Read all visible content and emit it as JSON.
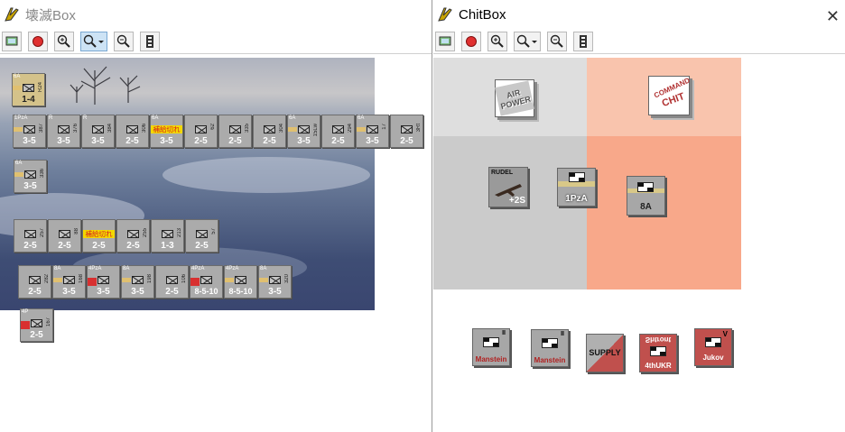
{
  "left_window": {
    "title": "壊滅Box",
    "toolbar": [
      "map-icon",
      "stop-icon",
      "zoom-in-icon",
      "zoom-dropdown-icon",
      "zoom-out-icon",
      "stack-icon"
    ],
    "counters": [
      {
        "lbl": "6A",
        "id": "R24",
        "str": "1-4",
        "style": "gold"
      },
      {
        "lbl": "1PzA",
        "id": "387",
        "str": "3-5"
      },
      {
        "lbl": "R",
        "id": "376",
        "str": "3-5"
      },
      {
        "lbl": "R",
        "id": "384",
        "str": "3-5"
      },
      {
        "lbl": "",
        "id": "306",
        "str": "2-5"
      },
      {
        "lbl": "6A",
        "id": "",
        "str": "3-5",
        "tag": "補給切れ"
      },
      {
        "lbl": "",
        "id": "62",
        "str": "2-5"
      },
      {
        "lbl": "",
        "id": "335",
        "str": "2-5"
      },
      {
        "lbl": "",
        "id": "304",
        "str": "2-5"
      },
      {
        "lbl": "6A",
        "id": "15Lw",
        "str": "3-5"
      },
      {
        "lbl": "",
        "id": "294",
        "str": "2-5"
      },
      {
        "lbl": "6A",
        "id": "17",
        "str": "3-5"
      },
      {
        "lbl": "",
        "id": "3Rt",
        "str": "2-5"
      },
      {
        "lbl": "6A",
        "id": "336",
        "str": "3-5"
      },
      {
        "lbl": "",
        "id": "257",
        "str": "2-5"
      },
      {
        "lbl": "",
        "id": "88",
        "str": "2-5"
      },
      {
        "lbl": "",
        "id": "",
        "str": "2-5",
        "tag": "補給切れ"
      },
      {
        "lbl": "",
        "id": "255",
        "str": "2-5"
      },
      {
        "lbl": "",
        "id": "213",
        "str": "1-3"
      },
      {
        "lbl": "",
        "id": "57",
        "str": "2-5"
      },
      {
        "lbl": "",
        "id": "282",
        "str": "2-5"
      },
      {
        "lbl": "8A",
        "id": "168",
        "str": "3-5"
      },
      {
        "lbl": "4PzA",
        "id": "",
        "str": "3-5",
        "red": true
      },
      {
        "lbl": "8A",
        "id": "198",
        "str": "3-5"
      },
      {
        "lbl": "",
        "id": "106",
        "str": "2-5"
      },
      {
        "lbl": "4PzA",
        "id": "",
        "str": "8-5-10",
        "red": true
      },
      {
        "lbl": "4PzA",
        "id": "",
        "str": "8-5-10"
      },
      {
        "lbl": "8A",
        "id": "320",
        "str": "3-5"
      },
      {
        "lbl": "4P",
        "id": "167",
        "str": "2-5",
        "red": true
      }
    ]
  },
  "right_window": {
    "title": "ChitBox",
    "close_label": "✕",
    "toolbar": [
      "map-icon",
      "stop-icon",
      "zoom-in-icon",
      "zoom-dropdown-icon",
      "zoom-out-icon",
      "stack-icon"
    ],
    "chits": {
      "air_power": "AIR POWER",
      "command": "COMMAND",
      "chit": "CHIT",
      "rudel_name": "RUDEL",
      "rudel_val": "+2S",
      "pza": "1PzA",
      "eight_a": "8A",
      "manstein1": "Manstein",
      "manstein1_sup": "II",
      "manstein2": "Manstein",
      "manstein2_sup": "II",
      "supply": "SUPPLY",
      "ukr_top": "4thUKR",
      "ukr_mirror": "Shtront",
      "ukr_bottom": "4thUKR",
      "zhukov": "Jukov",
      "zhukov_sup": "V"
    }
  },
  "colors": {
    "zone_grey_top": "#dedede",
    "zone_grey_bottom": "#cbcbcb",
    "zone_salmon_top": "#f9c4ad",
    "zone_salmon_bottom": "#f8a88a",
    "soviet_red": "#c0504d"
  }
}
